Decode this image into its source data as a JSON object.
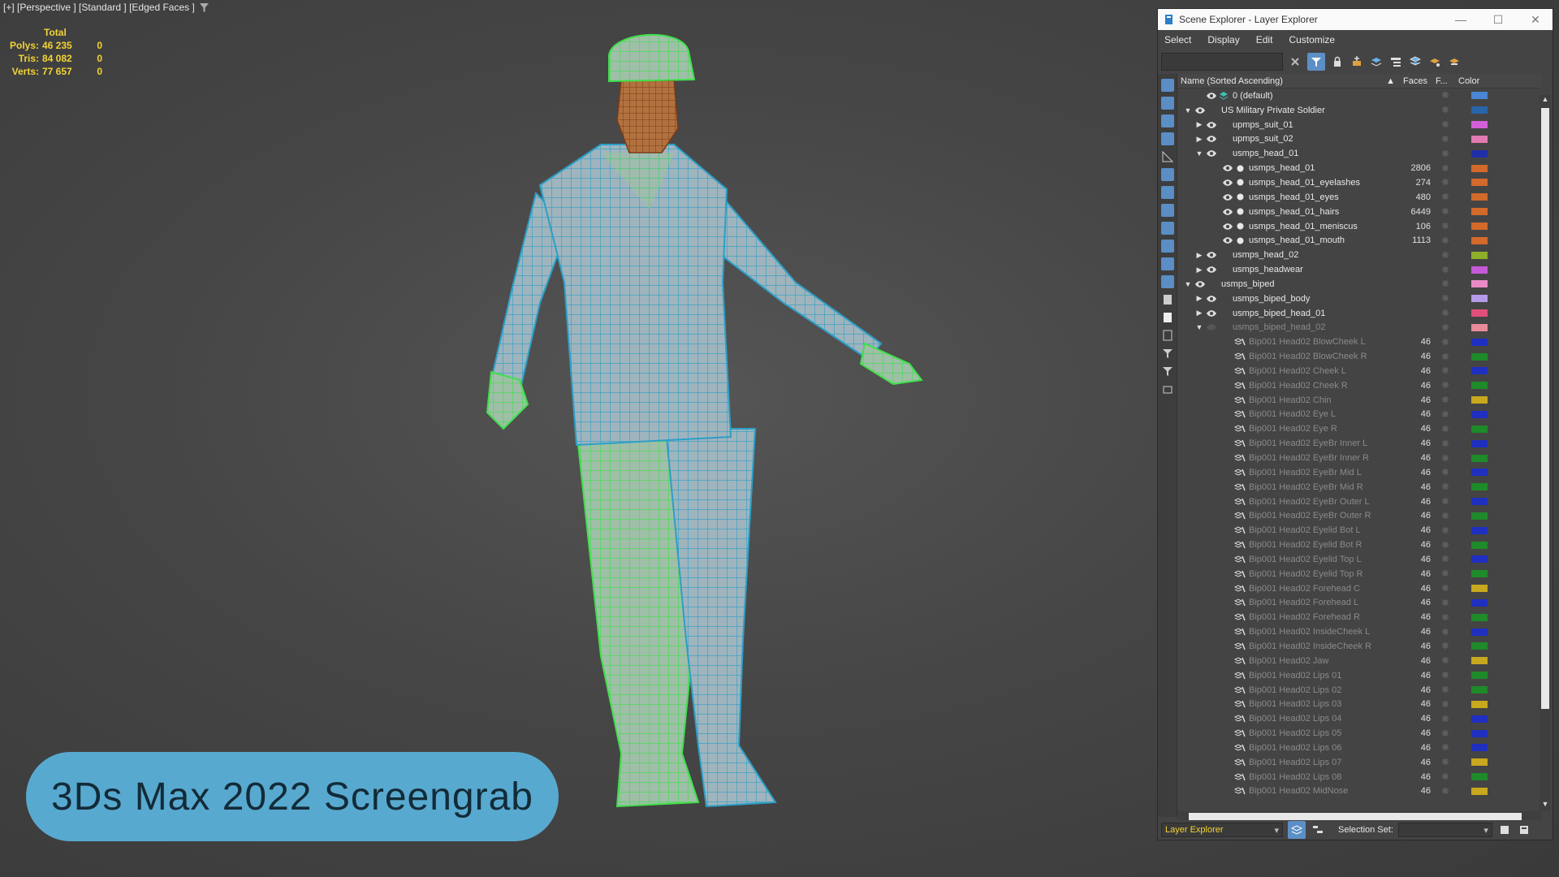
{
  "viewport": {
    "label": "[+] [Perspective ] [Standard ] [Edged Faces ]",
    "stats": {
      "header": "Total",
      "rows": [
        {
          "key": "Polys:",
          "value": "46 235",
          "sel": "0"
        },
        {
          "key": "Tris:",
          "value": "84 082",
          "sel": "0"
        },
        {
          "key": "Verts:",
          "value": "77 657",
          "sel": "0"
        }
      ]
    }
  },
  "badge": {
    "text": "3Ds Max 2022 Screengrab"
  },
  "explorer": {
    "title": "Scene Explorer - Layer Explorer",
    "menu": [
      "Select",
      "Display",
      "Edit",
      "Customize"
    ],
    "columns": {
      "name": "Name (Sorted Ascending)",
      "sort": "▲",
      "faces": "Faces",
      "f": "F...",
      "color": "Color"
    },
    "bottom": {
      "explorer_select": "Layer Explorer",
      "selection_set_label": "Selection Set:",
      "selection_set_value": ""
    },
    "rows": [
      {
        "indent": 1,
        "arrow": "",
        "icon": "layer",
        "name": "0 (default)",
        "faces": "",
        "color": "#4a86d4",
        "dim": false
      },
      {
        "indent": 0,
        "arrow": "down",
        "icon": "none",
        "name": "US Military Private Soldier",
        "faces": "",
        "color": "#2864a8",
        "dim": false
      },
      {
        "indent": 1,
        "arrow": "right",
        "icon": "none",
        "name": "upmps_suit_01",
        "faces": "",
        "color": "#d160d8",
        "dim": false
      },
      {
        "indent": 1,
        "arrow": "right",
        "icon": "none",
        "name": "upmps_suit_02",
        "faces": "",
        "color": "#e07ab0",
        "dim": false
      },
      {
        "indent": 1,
        "arrow": "down",
        "icon": "none",
        "name": "usmps_head_01",
        "faces": "",
        "color": "#1f2fa8",
        "dim": false
      },
      {
        "indent": 2,
        "arrow": "",
        "icon": "obj",
        "name": "usmps_head_01",
        "faces": "2806",
        "color": "#d26a2c",
        "dim": false
      },
      {
        "indent": 2,
        "arrow": "",
        "icon": "obj",
        "name": "usmps_head_01_eyelashes",
        "faces": "274",
        "color": "#d26a2c",
        "dim": false
      },
      {
        "indent": 2,
        "arrow": "",
        "icon": "obj",
        "name": "usmps_head_01_eyes",
        "faces": "480",
        "color": "#d26a2c",
        "dim": false
      },
      {
        "indent": 2,
        "arrow": "",
        "icon": "obj",
        "name": "usmps_head_01_hairs",
        "faces": "6449",
        "color": "#d26a2c",
        "dim": false
      },
      {
        "indent": 2,
        "arrow": "",
        "icon": "obj",
        "name": "usmps_head_01_meniscus",
        "faces": "106",
        "color": "#d26a2c",
        "dim": false
      },
      {
        "indent": 2,
        "arrow": "",
        "icon": "obj",
        "name": "usmps_head_01_mouth",
        "faces": "1113",
        "color": "#d26a2c",
        "dim": false
      },
      {
        "indent": 1,
        "arrow": "right",
        "icon": "none",
        "name": "usmps_head_02",
        "faces": "",
        "color": "#8fae2a",
        "dim": false
      },
      {
        "indent": 1,
        "arrow": "right",
        "icon": "none",
        "name": "usmps_headwear",
        "faces": "",
        "color": "#c45ad8",
        "dim": false
      },
      {
        "indent": 0,
        "arrow": "down",
        "icon": "none",
        "name": "usmps_biped",
        "faces": "",
        "color": "#e88ac4",
        "dim": false
      },
      {
        "indent": 1,
        "arrow": "right",
        "icon": "none",
        "name": "usmps_biped_body",
        "faces": "",
        "color": "#b59ae8",
        "dim": false
      },
      {
        "indent": 1,
        "arrow": "right",
        "icon": "none",
        "name": "usmps_biped_head_01",
        "faces": "",
        "color": "#e0507a",
        "dim": false
      },
      {
        "indent": 1,
        "arrow": "down",
        "icon": "hidden",
        "name": "usmps_biped_head_02",
        "faces": "",
        "color": "#e88a9a",
        "dim": true
      },
      {
        "indent": 2,
        "arrow": "",
        "icon": "bone",
        "name": "Bip001 Head02 BlowCheek L",
        "faces": "46",
        "color": "#1f2fbf",
        "dim": true
      },
      {
        "indent": 2,
        "arrow": "",
        "icon": "bone",
        "name": "Bip001 Head02 BlowCheek R",
        "faces": "46",
        "color": "#1f8a2a",
        "dim": true
      },
      {
        "indent": 2,
        "arrow": "",
        "icon": "bone",
        "name": "Bip001 Head02 Cheek L",
        "faces": "46",
        "color": "#1f2fbf",
        "dim": true
      },
      {
        "indent": 2,
        "arrow": "",
        "icon": "bone",
        "name": "Bip001 Head02 Cheek R",
        "faces": "46",
        "color": "#1f8a2a",
        "dim": true
      },
      {
        "indent": 2,
        "arrow": "",
        "icon": "bone",
        "name": "Bip001 Head02 Chin",
        "faces": "46",
        "color": "#c8a81e",
        "dim": true
      },
      {
        "indent": 2,
        "arrow": "",
        "icon": "bone",
        "name": "Bip001 Head02 Eye L",
        "faces": "46",
        "color": "#1f2fbf",
        "dim": true
      },
      {
        "indent": 2,
        "arrow": "",
        "icon": "bone",
        "name": "Bip001 Head02 Eye R",
        "faces": "46",
        "color": "#1f8a2a",
        "dim": true
      },
      {
        "indent": 2,
        "arrow": "",
        "icon": "bone",
        "name": "Bip001 Head02 EyeBr Inner L",
        "faces": "46",
        "color": "#1f2fbf",
        "dim": true
      },
      {
        "indent": 2,
        "arrow": "",
        "icon": "bone",
        "name": "Bip001 Head02 EyeBr Inner R",
        "faces": "46",
        "color": "#1f8a2a",
        "dim": true
      },
      {
        "indent": 2,
        "arrow": "",
        "icon": "bone",
        "name": "Bip001 Head02 EyeBr Mid L",
        "faces": "46",
        "color": "#1f2fbf",
        "dim": true
      },
      {
        "indent": 2,
        "arrow": "",
        "icon": "bone",
        "name": "Bip001 Head02 EyeBr Mid R",
        "faces": "46",
        "color": "#1f8a2a",
        "dim": true
      },
      {
        "indent": 2,
        "arrow": "",
        "icon": "bone",
        "name": "Bip001 Head02 EyeBr Outer L",
        "faces": "46",
        "color": "#1f2fbf",
        "dim": true
      },
      {
        "indent": 2,
        "arrow": "",
        "icon": "bone",
        "name": "Bip001 Head02 EyeBr Outer R",
        "faces": "46",
        "color": "#1f8a2a",
        "dim": true
      },
      {
        "indent": 2,
        "arrow": "",
        "icon": "bone",
        "name": "Bip001 Head02 Eyelid Bot L",
        "faces": "46",
        "color": "#1f2fbf",
        "dim": true
      },
      {
        "indent": 2,
        "arrow": "",
        "icon": "bone",
        "name": "Bip001 Head02 Eyelid Bot R",
        "faces": "46",
        "color": "#1f8a2a",
        "dim": true
      },
      {
        "indent": 2,
        "arrow": "",
        "icon": "bone",
        "name": "Bip001 Head02 Eyelid Top L",
        "faces": "46",
        "color": "#1f2fbf",
        "dim": true
      },
      {
        "indent": 2,
        "arrow": "",
        "icon": "bone",
        "name": "Bip001 Head02 Eyelid Top R",
        "faces": "46",
        "color": "#1f8a2a",
        "dim": true
      },
      {
        "indent": 2,
        "arrow": "",
        "icon": "bone",
        "name": "Bip001 Head02 Forehead C",
        "faces": "46",
        "color": "#c8a81e",
        "dim": true
      },
      {
        "indent": 2,
        "arrow": "",
        "icon": "bone",
        "name": "Bip001 Head02 Forehead L",
        "faces": "46",
        "color": "#1f2fbf",
        "dim": true
      },
      {
        "indent": 2,
        "arrow": "",
        "icon": "bone",
        "name": "Bip001 Head02 Forehead R",
        "faces": "46",
        "color": "#1f8a2a",
        "dim": true
      },
      {
        "indent": 2,
        "arrow": "",
        "icon": "bone",
        "name": "Bip001 Head02 InsideCheek L",
        "faces": "46",
        "color": "#1f2fbf",
        "dim": true
      },
      {
        "indent": 2,
        "arrow": "",
        "icon": "bone",
        "name": "Bip001 Head02 InsideCheek R",
        "faces": "46",
        "color": "#1f8a2a",
        "dim": true
      },
      {
        "indent": 2,
        "arrow": "",
        "icon": "bone",
        "name": "Bip001 Head02 Jaw",
        "faces": "46",
        "color": "#c8a81e",
        "dim": true
      },
      {
        "indent": 2,
        "arrow": "",
        "icon": "bone",
        "name": "Bip001 Head02 Lips 01",
        "faces": "46",
        "color": "#1f8a2a",
        "dim": true
      },
      {
        "indent": 2,
        "arrow": "",
        "icon": "bone",
        "name": "Bip001 Head02 Lips 02",
        "faces": "46",
        "color": "#1f8a2a",
        "dim": true
      },
      {
        "indent": 2,
        "arrow": "",
        "icon": "bone",
        "name": "Bip001 Head02 Lips 03",
        "faces": "46",
        "color": "#c8a81e",
        "dim": true
      },
      {
        "indent": 2,
        "arrow": "",
        "icon": "bone",
        "name": "Bip001 Head02 Lips 04",
        "faces": "46",
        "color": "#1f2fbf",
        "dim": true
      },
      {
        "indent": 2,
        "arrow": "",
        "icon": "bone",
        "name": "Bip001 Head02 Lips 05",
        "faces": "46",
        "color": "#1f2fbf",
        "dim": true
      },
      {
        "indent": 2,
        "arrow": "",
        "icon": "bone",
        "name": "Bip001 Head02 Lips 06",
        "faces": "46",
        "color": "#1f2fbf",
        "dim": true
      },
      {
        "indent": 2,
        "arrow": "",
        "icon": "bone",
        "name": "Bip001 Head02 Lips 07",
        "faces": "46",
        "color": "#c8a81e",
        "dim": true
      },
      {
        "indent": 2,
        "arrow": "",
        "icon": "bone",
        "name": "Bip001 Head02 Lips 08",
        "faces": "46",
        "color": "#1f8a2a",
        "dim": true
      },
      {
        "indent": 2,
        "arrow": "",
        "icon": "bone",
        "name": "Bip001 Head02 MidNose",
        "faces": "46",
        "color": "#c8a81e",
        "dim": true
      }
    ]
  }
}
